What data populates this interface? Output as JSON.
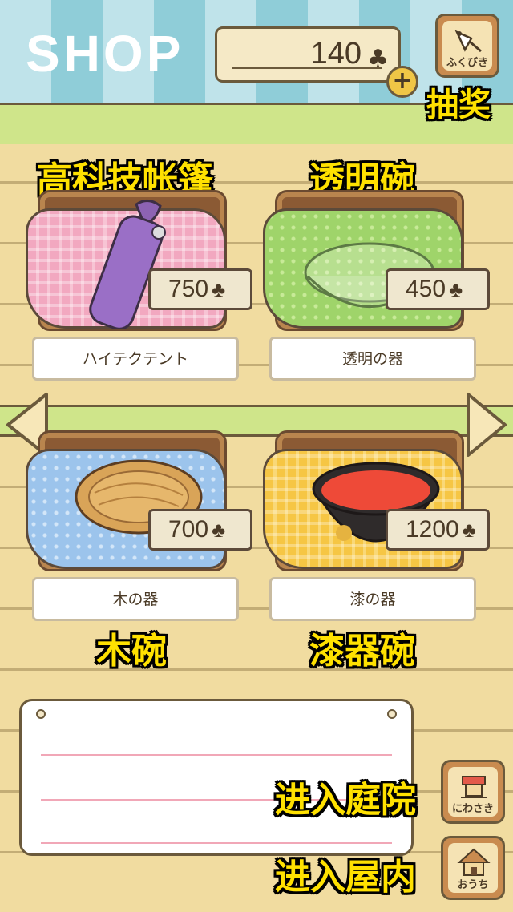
{
  "header": {
    "title": "SHOP",
    "coins": "140",
    "clover": "♣",
    "plus": "+"
  },
  "buttons": {
    "lottery_label": "ふくびき",
    "garden_label": "にわさき",
    "home_label": "おうち"
  },
  "annotations": {
    "lottery": "抽奖",
    "item1": "高科技帐篷",
    "item2": "透明碗",
    "item3": "木碗",
    "item4": "漆器碗",
    "garden": "进入庭院",
    "home": "进入屋内"
  },
  "items": [
    {
      "name": "ハイテクテント",
      "price": "750",
      "cloth_color": "#f2a8c0"
    },
    {
      "name": "透明の器",
      "price": "450",
      "cloth_color": "#9fd46a"
    },
    {
      "name": "木の器",
      "price": "700",
      "cloth_color": "#9cc4ec"
    },
    {
      "name": "漆の器",
      "price": "1200",
      "cloth_color": "#f6c644"
    }
  ],
  "colors": {
    "annotation_text": "#ffe100",
    "wood": "#f1dca0",
    "wall_stripe": "#8fcdd8"
  }
}
